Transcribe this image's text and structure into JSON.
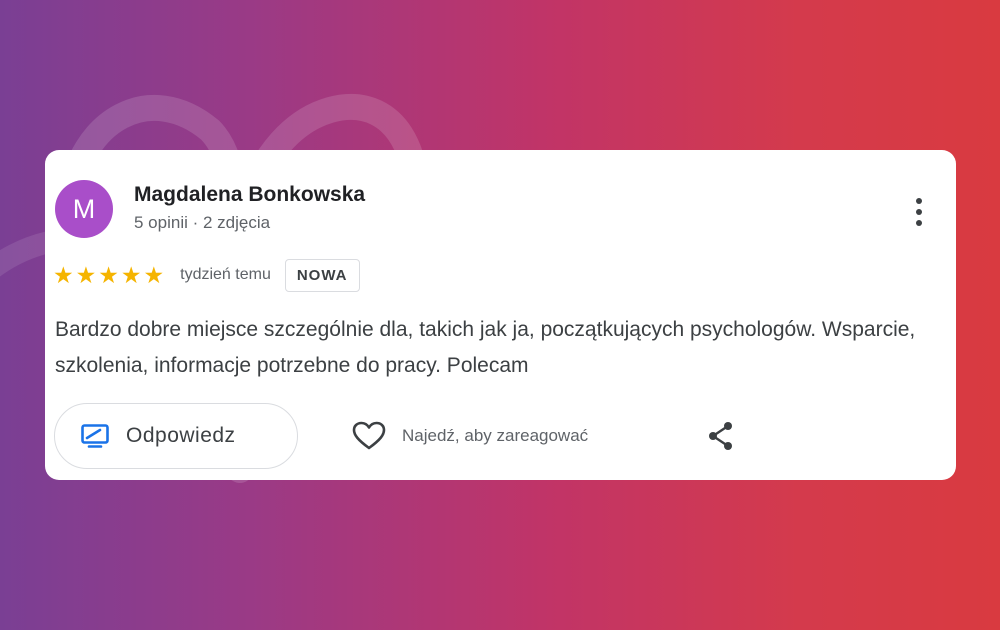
{
  "review": {
    "author": {
      "initial": "M",
      "name": "Magdalena Bonkowska",
      "meta": "5 opinii · 2 zdjęcia",
      "avatar_color": "#a94ec9"
    },
    "rating": 5,
    "stars": [
      "★",
      "★",
      "★",
      "★",
      "★"
    ],
    "star_color": "#f5b400",
    "time": "tydzień temu",
    "badge": "NOWA",
    "text": "Bardzo dobre miejsce szczególnie dla, takich jak ja, początkujących psychologów. Wsparcie, szkolenia, informacje potrzebne do pracy. Polecam"
  },
  "actions": {
    "reply_label": "Odpowiedz",
    "reply_icon": "reply-icon",
    "react_label": "Najedź, aby zareagować",
    "react_icon": "heart-icon",
    "share_icon": "share-icon",
    "more_icon": "more-vert-icon",
    "accent_color": "#1a73e8"
  },
  "background": {
    "gradient": [
      "#7a3f94",
      "#c13467",
      "#d93a40"
    ]
  }
}
